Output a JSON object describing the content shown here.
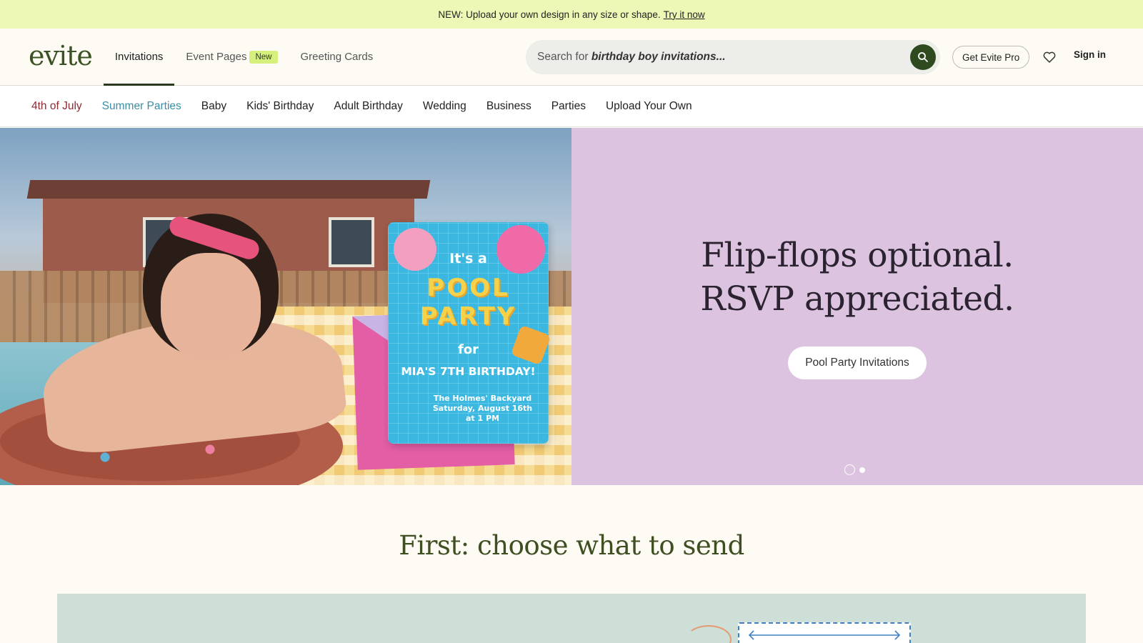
{
  "announcement": {
    "text": "NEW: Upload your own design in any size or shape.",
    "link": "Try it now"
  },
  "header": {
    "logo": "evite",
    "tabs": [
      {
        "label": "Invitations"
      },
      {
        "label": "Event Pages",
        "badge": "New"
      },
      {
        "label": "Greeting Cards"
      }
    ],
    "search": {
      "prefix": "Search for",
      "example": "birthday boy invitations..."
    },
    "pro_button": "Get Evite Pro",
    "sign_in": "Sign in"
  },
  "categories": [
    "4th of July",
    "Summer Parties",
    "Baby",
    "Kids' Birthday",
    "Adult Birthday",
    "Wedding",
    "Business",
    "Parties",
    "Upload Your Own"
  ],
  "hero": {
    "title_line1": "Flip-flops optional.",
    "title_line2": "RSVP appreciated.",
    "cta": "Pool Party Invitations",
    "card": {
      "line1": "It's a",
      "line2": "POOL",
      "line3": "PARTY",
      "line4": "for",
      "line5": "MIA'S 7TH BIRTHDAY!",
      "line6": "The Holmes' Backyard",
      "line7": "Saturday, August 16th",
      "line8": "at 1 PM"
    },
    "slides_total": 2,
    "slide_active": 1
  },
  "section": {
    "title": "First: choose what to send"
  },
  "colors": {
    "accent": "#2f4a1f",
    "announcement_bg": "#eef8b6",
    "hero_right_bg": "#dcc3e0",
    "category_red": "#8c2a33",
    "category_teal": "#3a8fa6"
  }
}
